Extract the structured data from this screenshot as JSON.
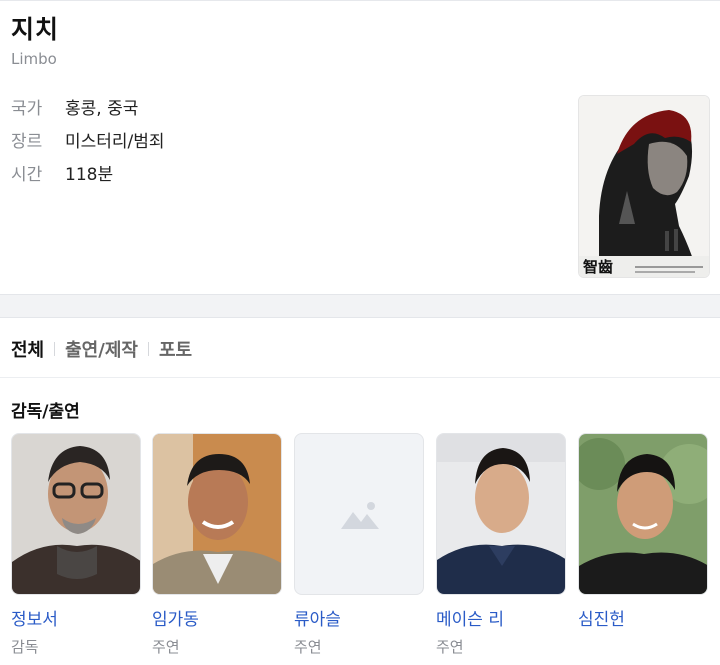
{
  "movie": {
    "title": "지치",
    "subtitle": "Limbo",
    "info": [
      {
        "label": "국가",
        "value": "홍콩, 중국"
      },
      {
        "label": "장르",
        "value": "미스터리/범죄"
      },
      {
        "label": "시간",
        "value": "118분"
      }
    ],
    "poster_text": "智齒"
  },
  "tabs": [
    {
      "label": "전체",
      "active": true
    },
    {
      "label": "출연/제작",
      "active": false
    },
    {
      "label": "포토",
      "active": false
    }
  ],
  "section": {
    "title": "감독/출연"
  },
  "cast": [
    {
      "name": "정보서",
      "role": "감독"
    },
    {
      "name": "임가동",
      "role": "주연"
    },
    {
      "name": "류아슬",
      "role": "주연"
    },
    {
      "name": "메이슨 리",
      "role": "주연"
    },
    {
      "name": "심진헌",
      "role": ""
    }
  ],
  "colors": {
    "link": "#2a5bc7",
    "muted": "#8a8d93",
    "band": "#f2f3f5"
  }
}
